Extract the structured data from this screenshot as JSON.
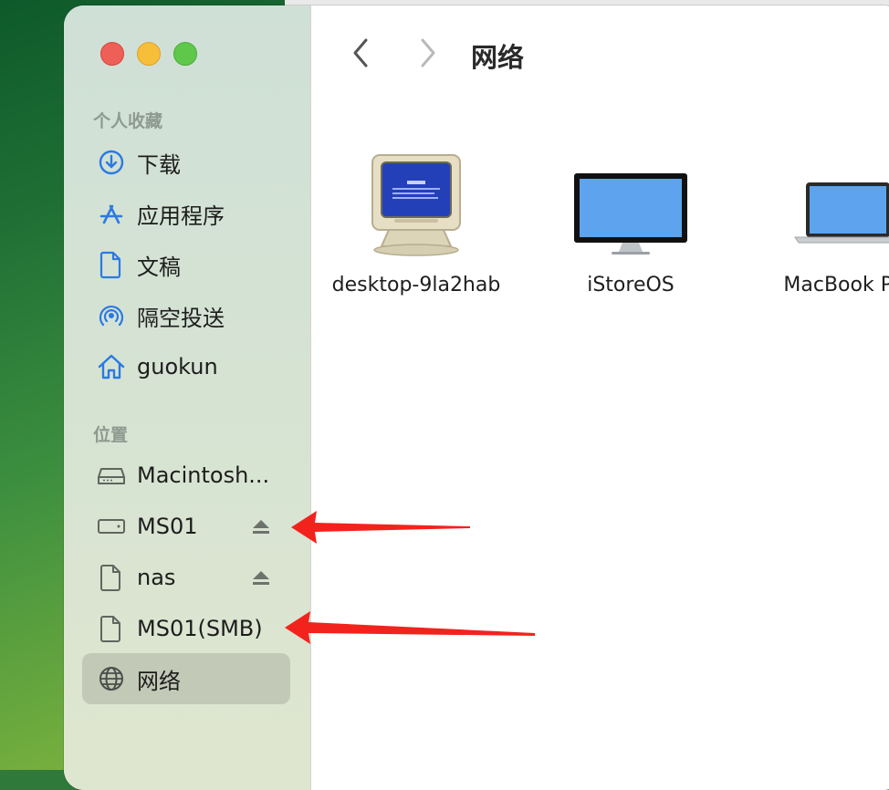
{
  "sidebar": {
    "favorites_header": "个人收藏",
    "locations_header": "位置",
    "favorites": [
      {
        "label": "下载",
        "icon": "download-circle-icon"
      },
      {
        "label": "应用程序",
        "icon": "app-store-icon"
      },
      {
        "label": "文稿",
        "icon": "document-icon"
      },
      {
        "label": "隔空投送",
        "icon": "airdrop-icon"
      },
      {
        "label": "guokun",
        "icon": "home-icon"
      }
    ],
    "locations": [
      {
        "label": "Macintosh...",
        "icon": "hard-drive-icon",
        "eject": false
      },
      {
        "label": "MS01",
        "icon": "network-drive-icon",
        "eject": true
      },
      {
        "label": "nas",
        "icon": "document-icon",
        "eject": true
      },
      {
        "label": "MS01(SMB)",
        "icon": "document-icon",
        "eject": false
      },
      {
        "label": "网络",
        "icon": "globe-icon",
        "eject": false,
        "selected": true
      }
    ]
  },
  "toolbar": {
    "title": "网络"
  },
  "files": [
    {
      "label": "desktop-9la2hab",
      "icon": "crt-monitor-icon"
    },
    {
      "label": "iStoreOS",
      "icon": "display-monitor-icon"
    },
    {
      "label": "MacBook Pro",
      "icon": "laptop-icon"
    }
  ],
  "colors": {
    "annotation_arrow": "#f2231d",
    "selected_item": "#c2c9b6",
    "accent_icon": "#2a7ae2"
  }
}
